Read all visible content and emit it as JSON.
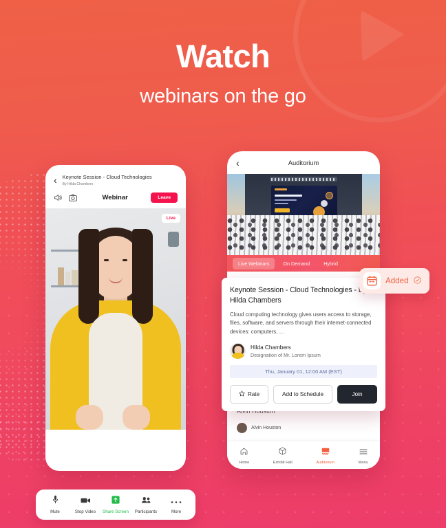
{
  "headline": {
    "title": "Watch",
    "subtitle": "webinars on the go"
  },
  "colors": {
    "bg_top": "#ef6047",
    "bg_bottom": "#ed3c6a",
    "accent_orange": "#f2603f",
    "accent_red": "#f5134d",
    "green": "#23bb49",
    "dark": "#22262e"
  },
  "left_phone": {
    "back_icon": "chevron-left-icon",
    "session_title": "Keynote Session - Cloud Technologies",
    "session_author": "By Hilda Chambers",
    "speaker_icon": "speaker-icon",
    "camera_icon": "camera-icon",
    "screen_label": "Webinar",
    "leave_label": "Leave",
    "live_label": "Live",
    "toolbar": [
      {
        "label": "Mute",
        "icon": "microphone-icon"
      },
      {
        "label": "Stop Video",
        "icon": "video-camera-icon"
      },
      {
        "label": "Share Screen",
        "icon": "share-screen-icon"
      },
      {
        "label": "Participants",
        "icon": "participants-icon"
      },
      {
        "label": "More",
        "icon": "more-dots-icon"
      }
    ]
  },
  "right_phone": {
    "back_icon": "chevron-left-icon",
    "title": "Auditorium",
    "tabs": [
      {
        "label": "Live Webinars",
        "active": true
      },
      {
        "label": "On Demand",
        "active": false
      },
      {
        "label": "Hybrid",
        "active": false
      }
    ],
    "background_list": [
      {
        "title": "Alvin Houston",
        "name": "Alvin Houston"
      }
    ],
    "nav": [
      {
        "label": "Home",
        "icon": "home-icon",
        "active": false
      },
      {
        "label": "Exhibit Hall",
        "icon": "cube-icon",
        "active": false
      },
      {
        "label": "Auditorium",
        "icon": "auditorium-icon",
        "active": true
      },
      {
        "label": "Menu",
        "icon": "hamburger-menu-icon",
        "active": false
      }
    ]
  },
  "session_card": {
    "title": "Keynote Session - Cloud Technologies - By Hilda Chambers",
    "description": "Cloud computing technology gives users access to storage, files, software, and servers through their internet-connected devices: computers, …",
    "speaker_name": "Hilda Chambers",
    "speaker_designation": "Designation of Mr. Lorem Ipsum",
    "date": "Thu, January 01, 12:00 AM (EST)",
    "rate_label": "Rate",
    "rate_icon": "star-icon",
    "schedule_label": "Add to Schedule",
    "join_label": "Join"
  },
  "added_badge": {
    "label": "Added",
    "calendar_icon": "calendar-icon",
    "check_icon": "check-circle-icon"
  }
}
